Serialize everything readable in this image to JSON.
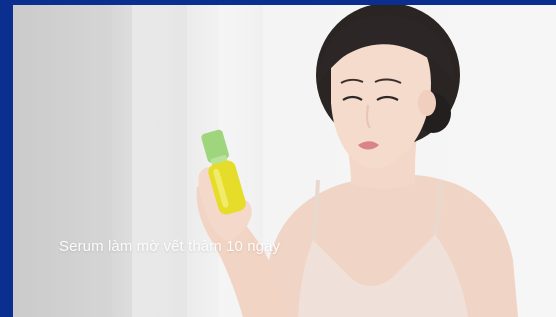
{
  "video": {
    "caption": "Serum làm mờ vết thâm 10 ngày"
  },
  "colors": {
    "frame": "#0a2f8f",
    "background": "#f4f4f4",
    "bottle": "#e5dd29",
    "bottle_cap": "#9fd57d",
    "skin": "#f2d6c7",
    "hair": "#2a2523",
    "top": "#eedfd6"
  }
}
